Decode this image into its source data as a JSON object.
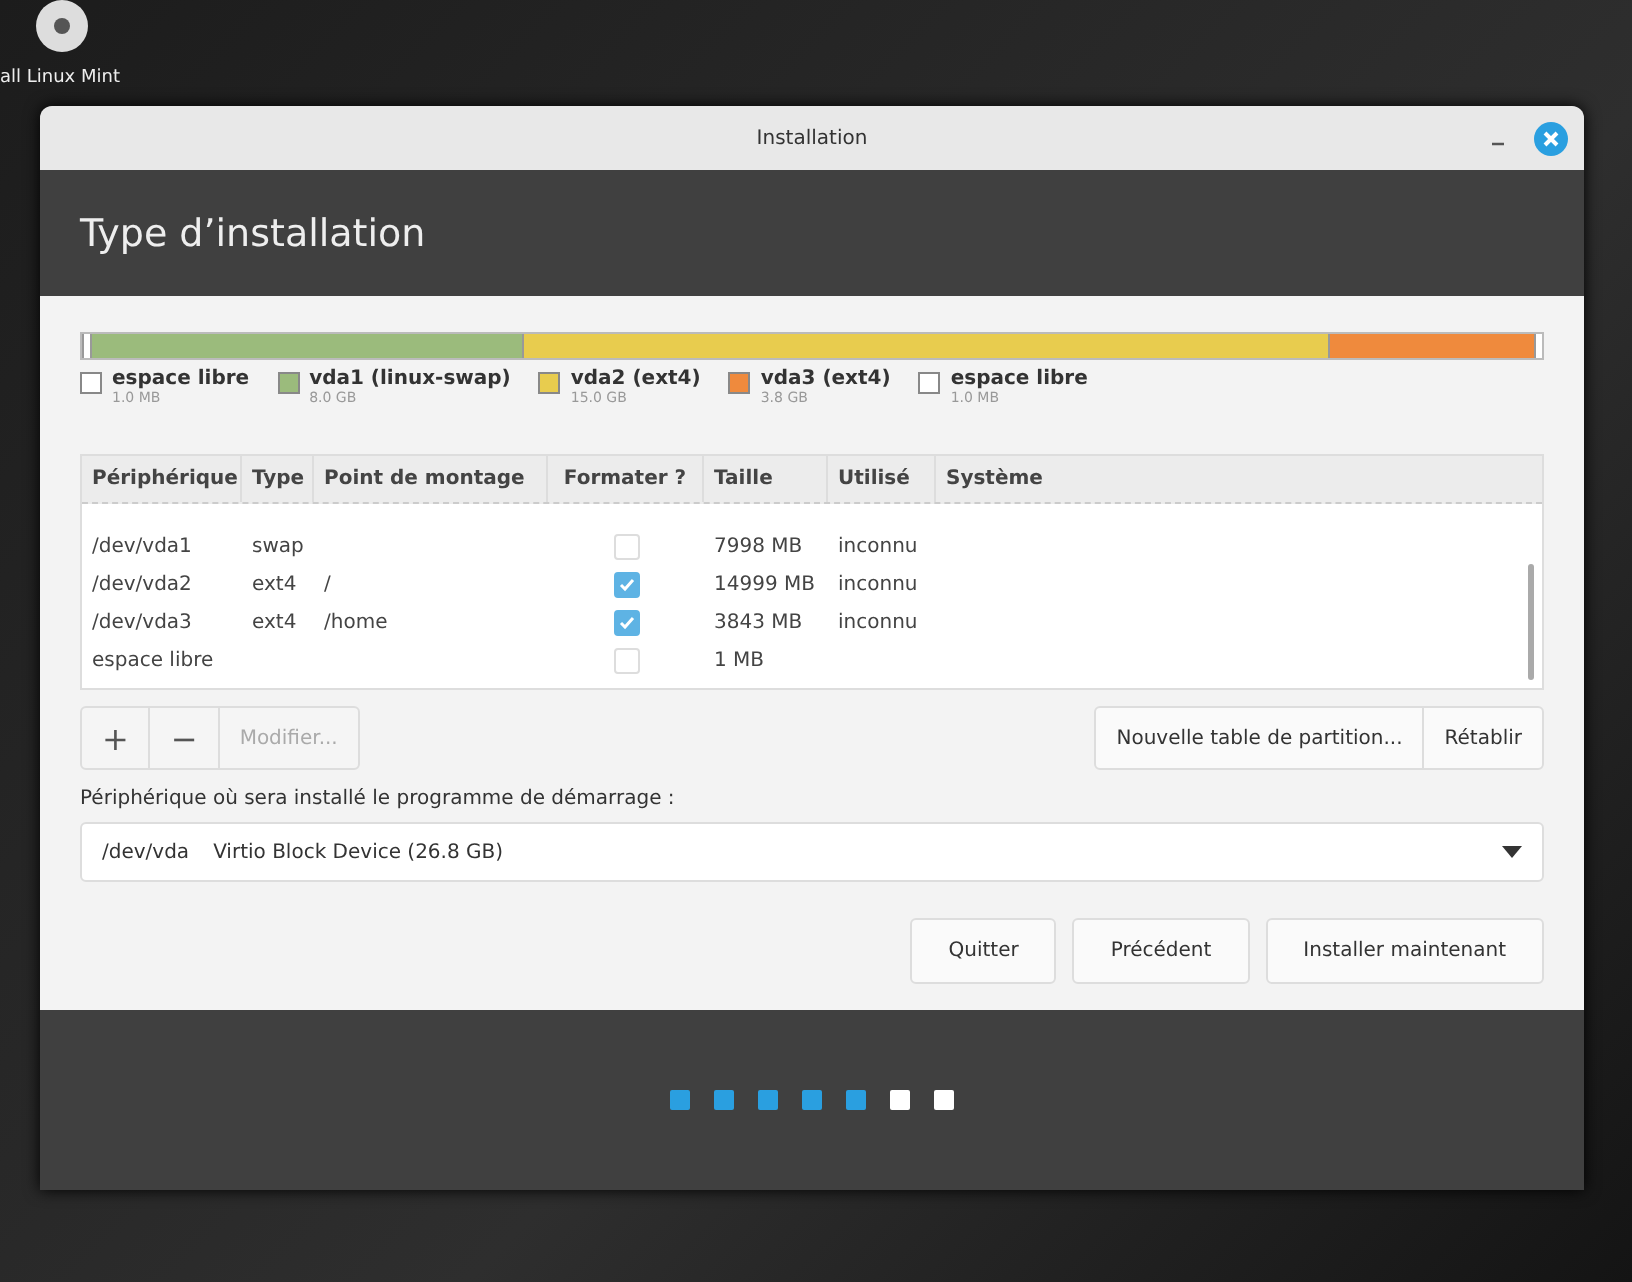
{
  "desktop_icon": {
    "label": "all Linux Mint"
  },
  "window": {
    "title": "Installation",
    "heading": "Type d’installation"
  },
  "partitions": [
    {
      "name": "espace libre",
      "size": "1.0 MB",
      "color": "#ffffff"
    },
    {
      "name": "vda1 (linux-swap)",
      "size": "8.0 GB",
      "color": "#9bbb7c"
    },
    {
      "name": "vda2 (ext4)",
      "size": "15.0 GB",
      "color": "#e8cc4e"
    },
    {
      "name": "vda3 (ext4)",
      "size": "3.8 GB",
      "color": "#ef8a3d"
    },
    {
      "name": "espace libre",
      "size": "1.0 MB",
      "color": "#ffffff"
    }
  ],
  "table": {
    "columns": [
      "Périphérique",
      "Type",
      "Point de montage",
      "Formater ?",
      "Taille",
      "Utilisé",
      "Système"
    ],
    "rows": [
      {
        "device": "/dev/vda1",
        "type": "swap",
        "mount": "",
        "format": false,
        "size": "7998 MB",
        "used": "inconnu"
      },
      {
        "device": "/dev/vda2",
        "type": "ext4",
        "mount": "/",
        "format": true,
        "size": "14999 MB",
        "used": "inconnu"
      },
      {
        "device": "/dev/vda3",
        "type": "ext4",
        "mount": "/home",
        "format": true,
        "size": "3843 MB",
        "used": "inconnu"
      },
      {
        "device": "espace libre",
        "type": "",
        "mount": "",
        "format": false,
        "size": "1 MB",
        "used": ""
      }
    ]
  },
  "toolbar": {
    "add": "+",
    "remove": "−",
    "modify": "Modifier...",
    "new_table": "Nouvelle table de partition...",
    "revert": "Rétablir"
  },
  "boot": {
    "label": "Périphérique où sera installé le programme de démarrage :",
    "device": "/dev/vda",
    "description": "Virtio Block Device (26.8 GB)"
  },
  "buttons": [
    "Quitter",
    "Précédent",
    "Installer maintenant"
  ],
  "steps": [
    {
      "completed": true
    },
    {
      "completed": true
    },
    {
      "completed": true
    },
    {
      "completed": true
    },
    {
      "completed": true
    },
    {
      "completed": false
    },
    {
      "completed": false
    }
  ]
}
